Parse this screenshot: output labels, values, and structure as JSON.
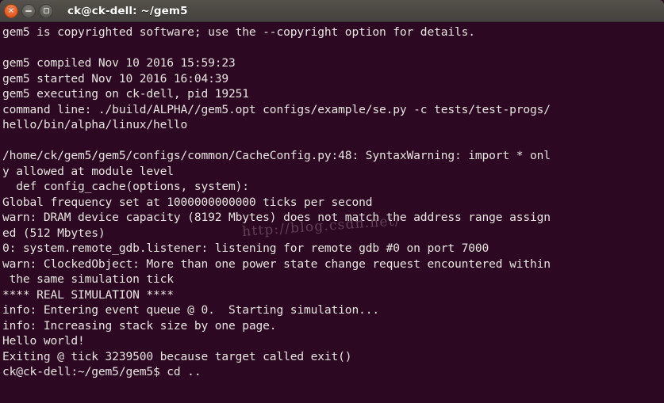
{
  "window": {
    "title": "ck@ck-dell: ~/gem5",
    "controls": [
      {
        "name": "close",
        "glyph": "×",
        "label": "Close"
      },
      {
        "name": "minimize",
        "glyph": "−",
        "label": "Minimize"
      },
      {
        "name": "maximize",
        "glyph": "□",
        "label": "Maximize"
      }
    ]
  },
  "colors": {
    "terminal_background": "#2d0822",
    "terminal_foreground": "#e8e4e1",
    "titlebar_background": "#4d4a45",
    "close_button": "#e8612a",
    "window_button_gray": "#5f5d58"
  },
  "terminal": {
    "lines": [
      "gem5 is copyrighted software; use the --copyright option for details.",
      "",
      "gem5 compiled Nov 10 2016 15:59:23",
      "gem5 started Nov 10 2016 16:04:39",
      "gem5 executing on ck-dell, pid 19251",
      "command line: ./build/ALPHA//gem5.opt configs/example/se.py -c tests/test-progs/",
      "hello/bin/alpha/linux/hello",
      "",
      "/home/ck/gem5/gem5/configs/common/CacheConfig.py:48: SyntaxWarning: import * onl",
      "y allowed at module level",
      "  def config_cache(options, system):",
      "Global frequency set at 1000000000000 ticks per second",
      "warn: DRAM device capacity (8192 Mbytes) does not match the address range assign",
      "ed (512 Mbytes)",
      "0: system.remote_gdb.listener: listening for remote gdb #0 on port 7000",
      "warn: ClockedObject: More than one power state change request encountered within",
      " the same simulation tick",
      "**** REAL SIMULATION ****",
      "info: Entering event queue @ 0.  Starting simulation...",
      "info: Increasing stack size by one page.",
      "Hello world!",
      "Exiting @ tick 3239500 because target called exit()",
      "ck@ck-dell:~/gem5/gem5$ cd .."
    ],
    "prompt": "ck@ck-dell:~/gem5/gem5$",
    "last_command": "cd .."
  },
  "watermark": {
    "text": "http://blog.csdn.net/"
  }
}
